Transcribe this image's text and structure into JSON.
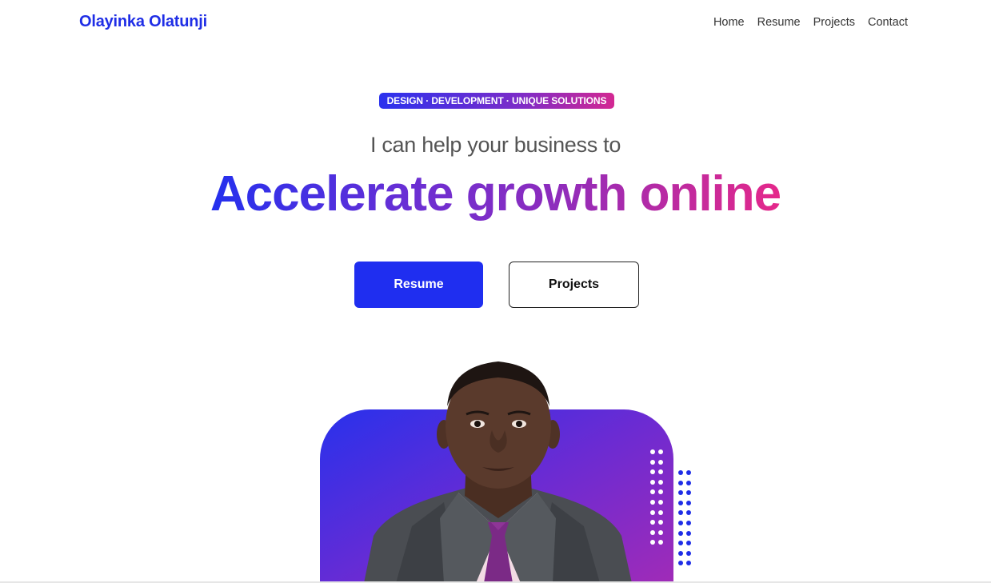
{
  "header": {
    "brand": "Olayinka Olatunji",
    "nav": [
      {
        "label": "Home"
      },
      {
        "label": "Resume"
      },
      {
        "label": "Projects"
      },
      {
        "label": "Contact"
      }
    ]
  },
  "hero": {
    "badge": "DESIGN · DEVELOPMENT · UNIQUE SOLUTIONS",
    "subheading": "I can help your business to",
    "headline": "Accelerate growth online",
    "buttons": {
      "primary_label": "Resume",
      "secondary_label": "Projects"
    }
  },
  "colors": {
    "brand_blue": "#1f2ee6",
    "gradient_start": "#2430ee",
    "gradient_mid": "#8d2cbd",
    "gradient_end": "#e5288a",
    "dots_white": "#ffffff",
    "dots_blue": "#1f2ee6"
  },
  "icons": {
    "portrait": "person-photo",
    "dot_pattern": "dot-grid-decoration"
  }
}
